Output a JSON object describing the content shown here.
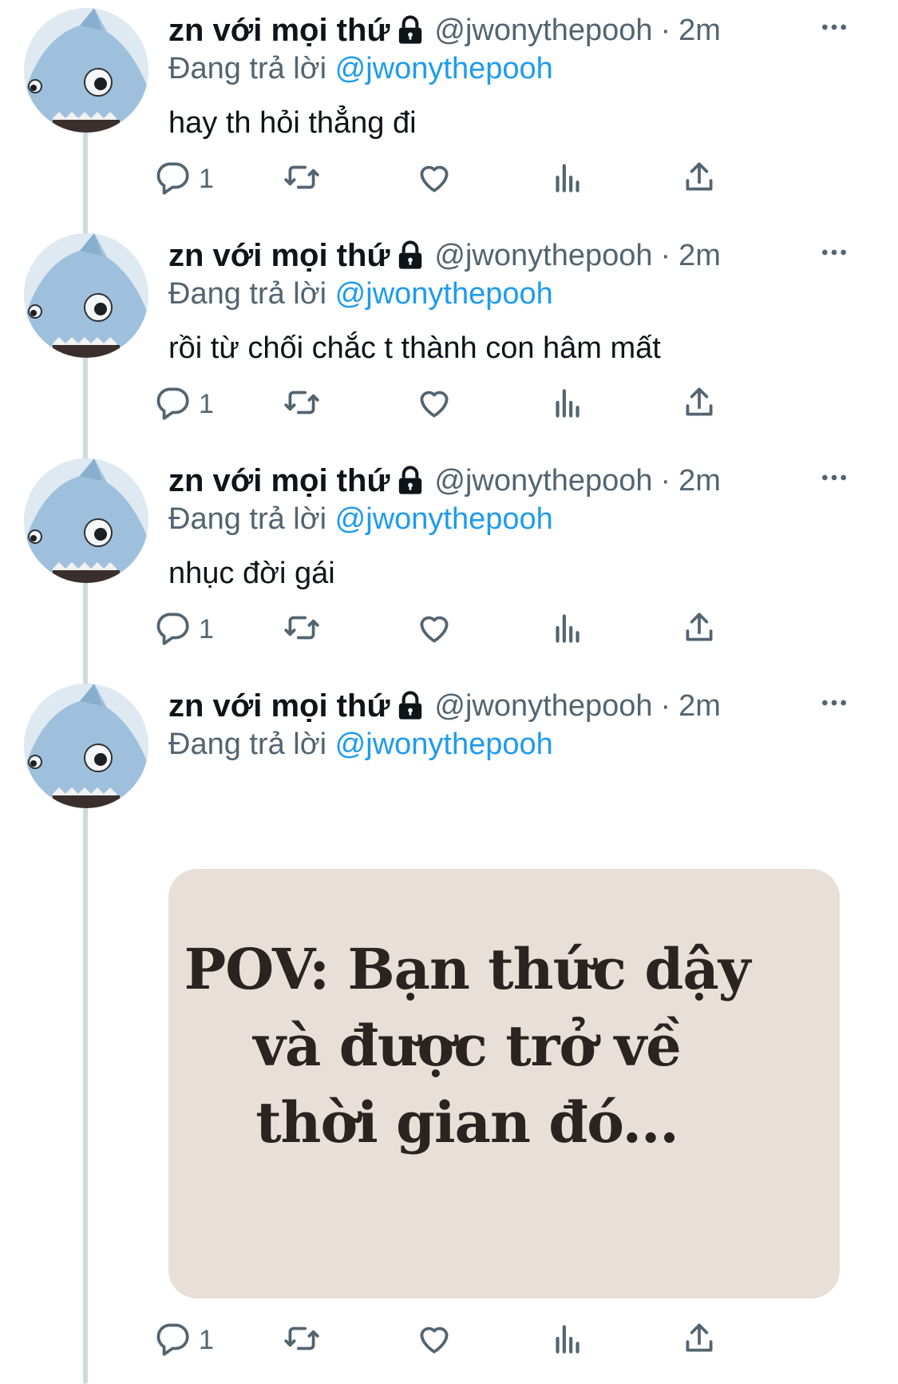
{
  "tweets": [
    {
      "author_name": "zn với mọi thứ",
      "handle": "@jwonythepooh",
      "separator": "·",
      "time": "2m",
      "reply_prefix": "Đang trả lời ",
      "reply_mention": "@jwonythepooh",
      "text": "hay th hỏi thẳng đi",
      "reply_count": "1"
    },
    {
      "author_name": "zn với mọi thứ",
      "handle": "@jwonythepooh",
      "separator": "·",
      "time": "2m",
      "reply_prefix": "Đang trả lời ",
      "reply_mention": "@jwonythepooh",
      "text": "rồi từ chối chắc t thành con hâm mất",
      "reply_count": "1"
    },
    {
      "author_name": "zn với mọi thứ",
      "handle": "@jwonythepooh",
      "separator": "·",
      "time": "2m",
      "reply_prefix": "Đang trả lời ",
      "reply_mention": "@jwonythepooh",
      "text": "nhục đời gái",
      "reply_count": "1"
    },
    {
      "author_name": "zn với mọi thứ",
      "handle": "@jwonythepooh",
      "separator": "·",
      "time": "2m",
      "reply_prefix": "Đang trả lời ",
      "reply_mention": "@jwonythepooh",
      "media_text": "POV: Bạn thức dậy\nvà được trở về\nthời gian đó...",
      "reply_count": "1"
    }
  ],
  "colors": {
    "link": "#1d9bf0",
    "secondary_text": "#536471",
    "thread_line": "#cfd9de",
    "media_background": "#e9dfd9"
  },
  "icons": [
    "lock-icon",
    "more-icon",
    "reply-icon",
    "retweet-icon",
    "like-icon",
    "views-icon",
    "share-icon"
  ]
}
